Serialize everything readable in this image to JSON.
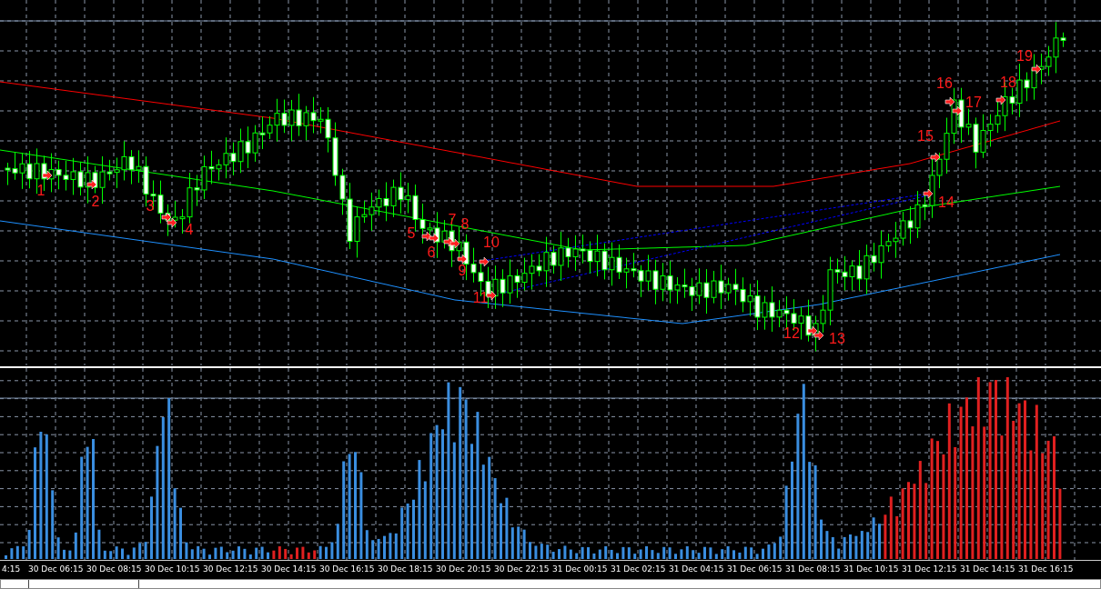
{
  "chart": {
    "annotations": [
      "1",
      "2",
      "3",
      "4",
      "5",
      "6",
      "7",
      "8",
      "9",
      "10",
      "11",
      "12",
      "13",
      "14",
      "15",
      "16",
      "17",
      "18",
      "19"
    ]
  },
  "time_axis": {
    "labels": [
      "4:15",
      "30 Dec 06:15",
      "30 Dec 08:15",
      "30 Dec 10:15",
      "30 Dec 12:15",
      "30 Dec 14:15",
      "30 Dec 16:15",
      "30 Dec 18:15",
      "30 Dec 20:15",
      "30 Dec 22:15",
      "31 Dec 00:15",
      "31 Dec 02:15",
      "31 Dec 04:15",
      "31 Dec 06:15",
      "31 Dec 08:15",
      "31 Dec 10:15",
      "31 Dec 12:15",
      "31 Dec 14:15",
      "31 Dec 16:15"
    ]
  }
}
